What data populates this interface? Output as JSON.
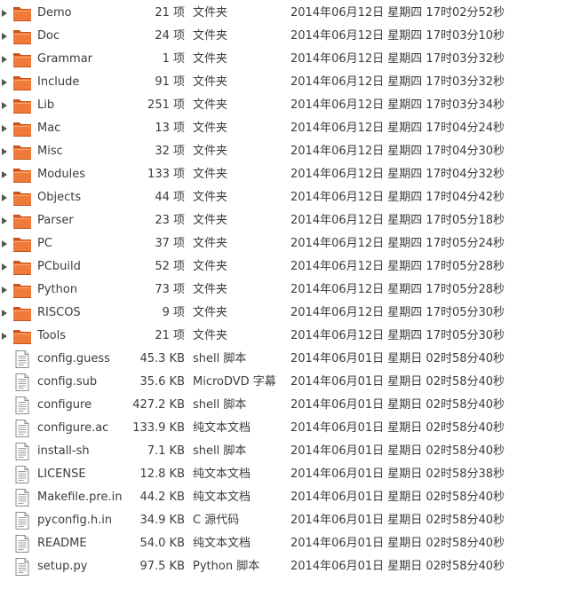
{
  "files": [
    {
      "name": "Demo",
      "size": "21 项",
      "type": "文件夹",
      "modified": "2014年06月12日 星期四 17时02分52秒",
      "kind": "folder"
    },
    {
      "name": "Doc",
      "size": "24 项",
      "type": "文件夹",
      "modified": "2014年06月12日 星期四 17时03分10秒",
      "kind": "folder"
    },
    {
      "name": "Grammar",
      "size": "1 项",
      "type": "文件夹",
      "modified": "2014年06月12日 星期四 17时03分32秒",
      "kind": "folder"
    },
    {
      "name": "Include",
      "size": "91 项",
      "type": "文件夹",
      "modified": "2014年06月12日 星期四 17时03分32秒",
      "kind": "folder"
    },
    {
      "name": "Lib",
      "size": "251 项",
      "type": "文件夹",
      "modified": "2014年06月12日 星期四 17时03分34秒",
      "kind": "folder"
    },
    {
      "name": "Mac",
      "size": "13 项",
      "type": "文件夹",
      "modified": "2014年06月12日 星期四 17时04分24秒",
      "kind": "folder"
    },
    {
      "name": "Misc",
      "size": "32 项",
      "type": "文件夹",
      "modified": "2014年06月12日 星期四 17时04分30秒",
      "kind": "folder"
    },
    {
      "name": "Modules",
      "size": "133 项",
      "type": "文件夹",
      "modified": "2014年06月12日 星期四 17时04分32秒",
      "kind": "folder"
    },
    {
      "name": "Objects",
      "size": "44 项",
      "type": "文件夹",
      "modified": "2014年06月12日 星期四 17时04分42秒",
      "kind": "folder"
    },
    {
      "name": "Parser",
      "size": "23 项",
      "type": "文件夹",
      "modified": "2014年06月12日 星期四 17时05分18秒",
      "kind": "folder"
    },
    {
      "name": "PC",
      "size": "37 项",
      "type": "文件夹",
      "modified": "2014年06月12日 星期四 17时05分24秒",
      "kind": "folder"
    },
    {
      "name": "PCbuild",
      "size": "52 项",
      "type": "文件夹",
      "modified": "2014年06月12日 星期四 17时05分28秒",
      "kind": "folder"
    },
    {
      "name": "Python",
      "size": "73 项",
      "type": "文件夹",
      "modified": "2014年06月12日 星期四 17时05分28秒",
      "kind": "folder"
    },
    {
      "name": "RISCOS",
      "size": "9 项",
      "type": "文件夹",
      "modified": "2014年06月12日 星期四 17时05分30秒",
      "kind": "folder"
    },
    {
      "name": "Tools",
      "size": "21 项",
      "type": "文件夹",
      "modified": "2014年06月12日 星期四 17时05分30秒",
      "kind": "folder"
    },
    {
      "name": "config.guess",
      "size": "45.3 KB",
      "type": "shell 脚本",
      "modified": "2014年06月01日 星期日 02时58分40秒",
      "kind": "file"
    },
    {
      "name": "config.sub",
      "size": "35.6 KB",
      "type": "MicroDVD 字幕",
      "modified": "2014年06月01日 星期日 02时58分40秒",
      "kind": "file"
    },
    {
      "name": "configure",
      "size": "427.2 KB",
      "type": "shell 脚本",
      "modified": "2014年06月01日 星期日 02时58分40秒",
      "kind": "file"
    },
    {
      "name": "configure.ac",
      "size": "133.9 KB",
      "type": "纯文本文档",
      "modified": "2014年06月01日 星期日 02时58分40秒",
      "kind": "file"
    },
    {
      "name": "install-sh",
      "size": "7.1 KB",
      "type": "shell 脚本",
      "modified": "2014年06月01日 星期日 02时58分40秒",
      "kind": "file"
    },
    {
      "name": "LICENSE",
      "size": "12.8 KB",
      "type": "纯文本文档",
      "modified": "2014年06月01日 星期日 02时58分38秒",
      "kind": "file"
    },
    {
      "name": "Makefile.pre.in",
      "size": "44.2 KB",
      "type": "纯文本文档",
      "modified": "2014年06月01日 星期日 02时58分40秒",
      "kind": "file"
    },
    {
      "name": "pyconfig.h.in",
      "size": "34.9 KB",
      "type": "C 源代码",
      "modified": "2014年06月01日 星期日 02时58分40秒",
      "kind": "file"
    },
    {
      "name": "README",
      "size": "54.0 KB",
      "type": "纯文本文档",
      "modified": "2014年06月01日 星期日 02时58分40秒",
      "kind": "file"
    },
    {
      "name": "setup.py",
      "size": "97.5 KB",
      "type": "Python 脚本",
      "modified": "2014年06月01日 星期日 02时58分40秒",
      "kind": "file"
    }
  ],
  "icons": {
    "folder": "folder-icon",
    "file": "text-file-icon",
    "expander": "expander-arrow-icon"
  },
  "colors": {
    "folder_orange": "#f07a3a",
    "folder_dark": "#c9541c",
    "text": "#3c3c3c"
  }
}
